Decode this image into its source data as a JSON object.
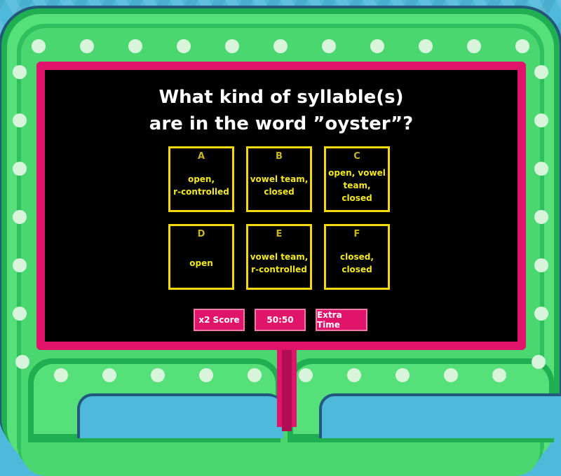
{
  "question": {
    "text": "What kind of syllable(s)\nare in the word ”oyster”?"
  },
  "answers": [
    {
      "letter": "A",
      "text": "open,\nr-controlled"
    },
    {
      "letter": "B",
      "text": "vowel team,\nclosed"
    },
    {
      "letter": "C",
      "text": "open, vowel\nteam, closed"
    },
    {
      "letter": "D",
      "text": "open"
    },
    {
      "letter": "E",
      "text": "vowel team,\nr-controlled"
    },
    {
      "letter": "F",
      "text": "closed,\nclosed"
    }
  ],
  "powerups": [
    {
      "label": "x2 Score"
    },
    {
      "label": "50:50"
    },
    {
      "label": "Extra Time"
    }
  ],
  "colors": {
    "background": "#4fb9dc",
    "frame_green": "#1fae52",
    "frame_light": "#55e07a",
    "screen_border": "#e0146a",
    "answer_yellow": "#f2e81c",
    "powerup_pink": "#e0146a"
  }
}
